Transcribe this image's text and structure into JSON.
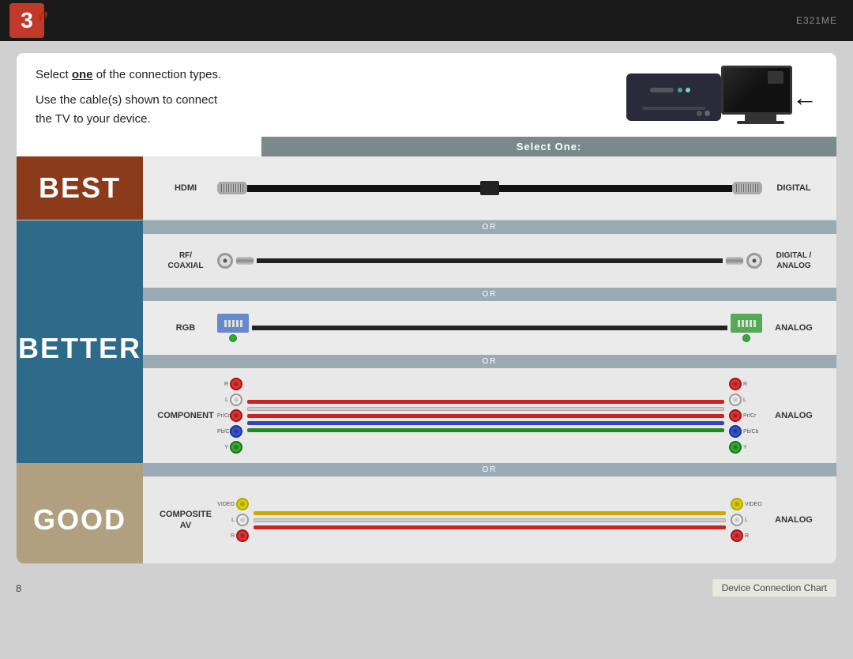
{
  "topBar": {
    "stepNumber": "3",
    "modelNumber": "E321ME"
  },
  "header": {
    "instructionLine1": "Select ",
    "instructionBold": "one",
    "instructionLine1b": " of the connection types.",
    "instructionLine2": "Use the cable(s) shown to connect",
    "instructionLine3": "the TV to your device.",
    "selectOneBanner": "Select One:"
  },
  "sections": {
    "best": {
      "label": "BEST",
      "connections": [
        {
          "leftLabel": "HDMI",
          "rightLabel": "DIGITAL",
          "type": "hdmi"
        }
      ]
    },
    "better": {
      "label": "BETTER",
      "connections": [
        {
          "leftLabel": "RF/\nCOAXIAL",
          "rightLabel": "DIGITAL /\nANALOG",
          "type": "coaxial"
        },
        {
          "leftLabel": "RGB",
          "rightLabel": "ANALOG",
          "type": "rgb"
        },
        {
          "leftLabel": "COMPONENT",
          "rightLabel": "ANALOG",
          "type": "component"
        }
      ]
    },
    "good": {
      "label": "GOOD",
      "connections": [
        {
          "leftLabel": "COMPOSITE\nAV",
          "rightLabel": "ANALOG",
          "type": "composite"
        }
      ]
    }
  },
  "footer": {
    "pageNumber": "8",
    "chartLabel": "Device Connection Chart"
  },
  "orText": "OR",
  "colors": {
    "bestBg": "#8b3a1a",
    "betterBg": "#2e6a8a",
    "goodBg": "#b0a080",
    "orBannerBg": "#9aabb5",
    "selectOneBg": "#7a8a8a"
  }
}
